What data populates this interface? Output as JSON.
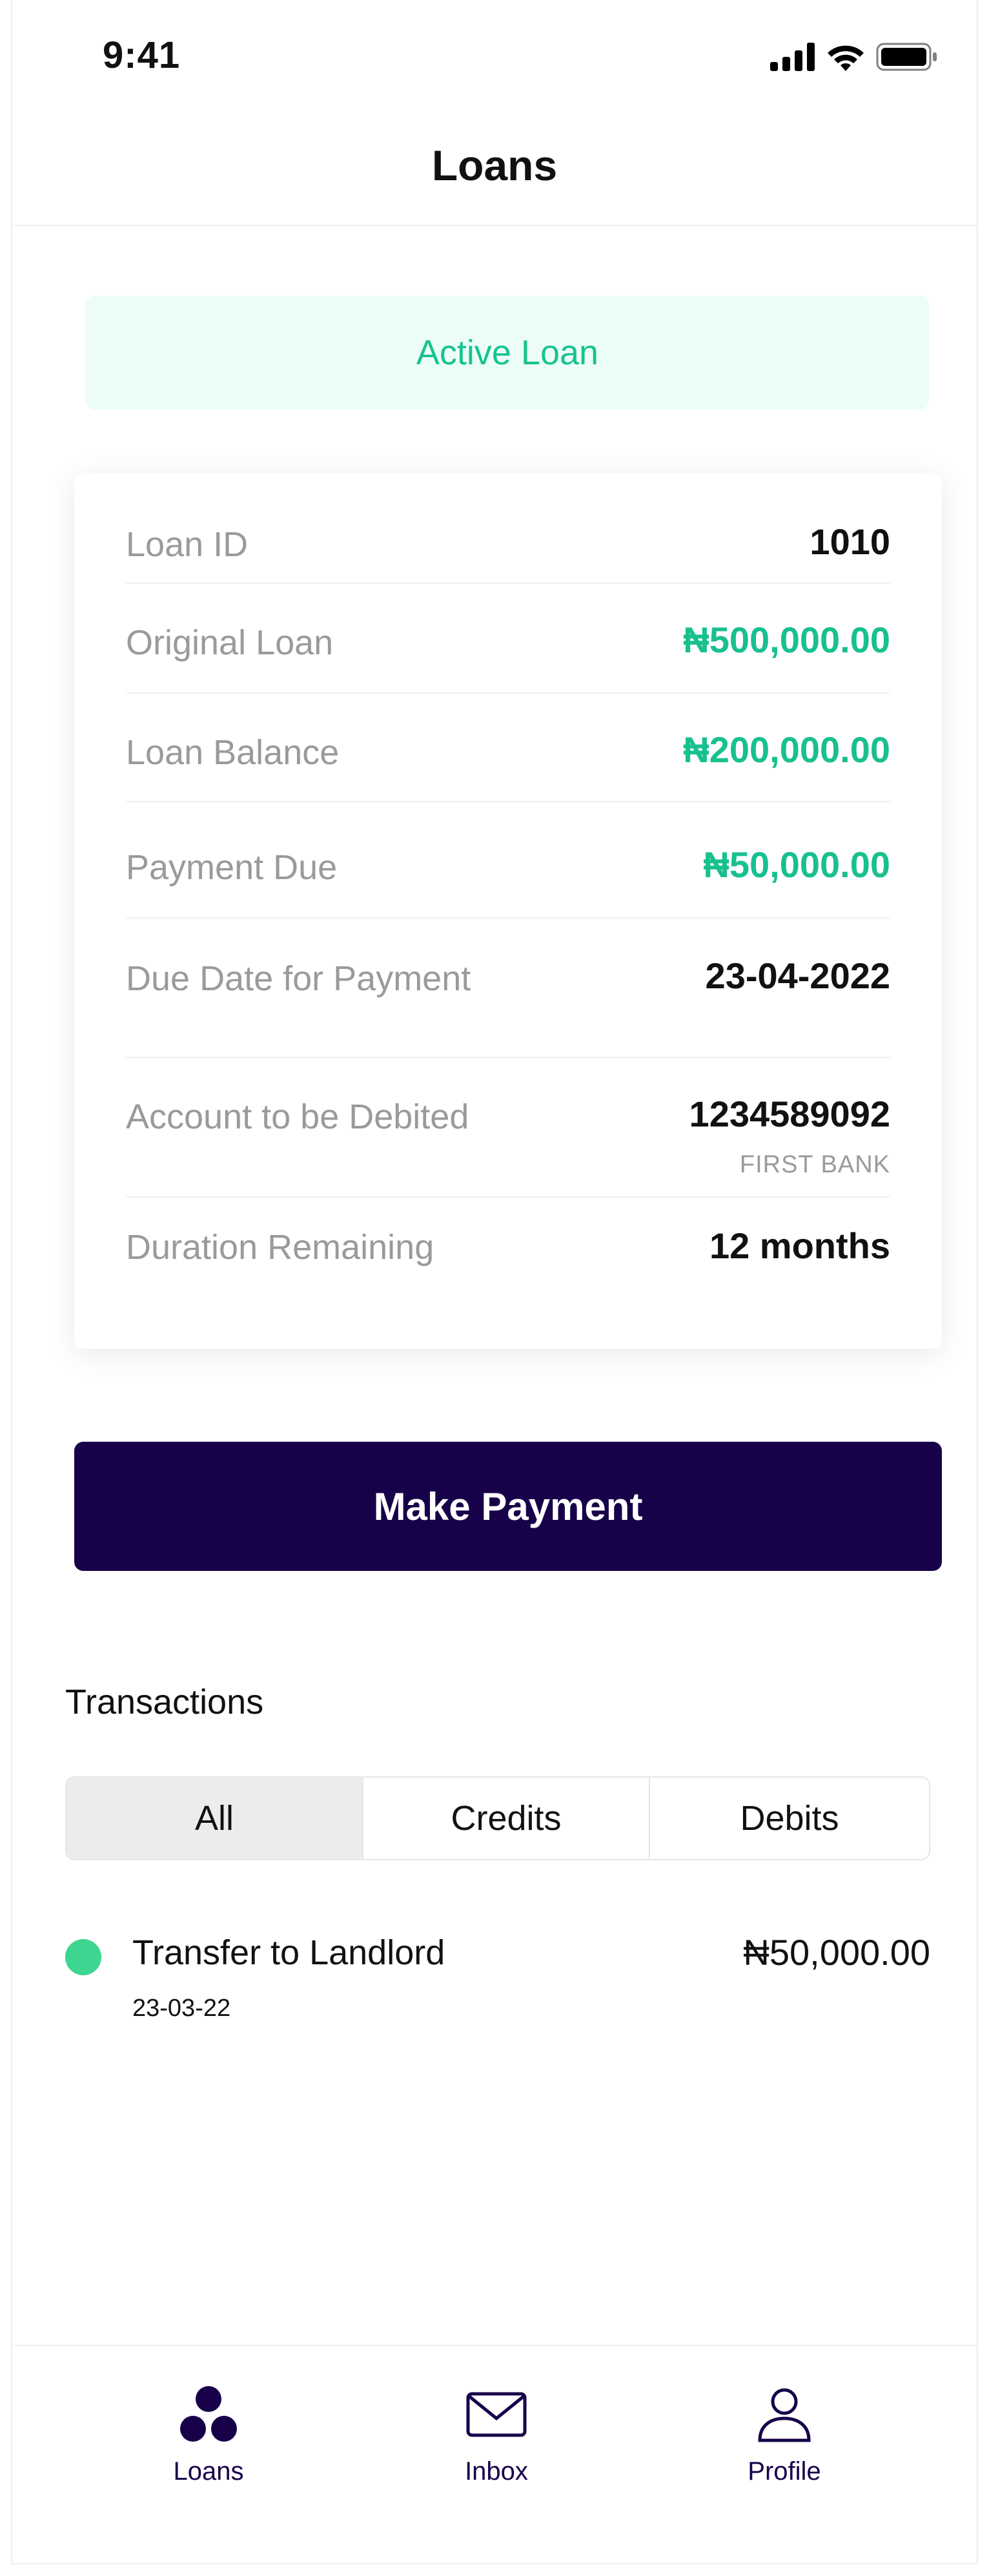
{
  "status_bar": {
    "time": "9:41",
    "icons": [
      "signal-icon",
      "wifi-icon",
      "battery-icon"
    ]
  },
  "header": {
    "title": "Loans"
  },
  "banner": {
    "label": "Active Loan"
  },
  "loan_details": {
    "loan_id": {
      "label": "Loan ID",
      "value": "1010"
    },
    "original_loan": {
      "label": "Original Loan",
      "value": "₦500,000.00"
    },
    "loan_balance": {
      "label": "Loan Balance",
      "value": "₦200,000.00"
    },
    "payment_due": {
      "label": "Payment Due",
      "value": "₦50,000.00"
    },
    "due_date": {
      "label": "Due Date for Payment",
      "value": "23-04-2022"
    },
    "account": {
      "label": "Account to be Debited",
      "value": "1234589092",
      "bank": "FIRST BANK"
    },
    "duration": {
      "label": "Duration Remaining",
      "value": "12 months"
    }
  },
  "actions": {
    "make_payment": "Make Payment"
  },
  "transactions": {
    "title": "Transactions",
    "tabs": [
      "All",
      "Credits",
      "Debits"
    ],
    "active_tab": "All",
    "items": [
      {
        "title": "Transfer to Landlord",
        "date": "23-03-22",
        "amount": "₦50,000.00",
        "status_color": "#3dd58f"
      }
    ]
  },
  "bottom_nav": {
    "items": [
      {
        "label": "Loans",
        "icon": "loans-icon"
      },
      {
        "label": "Inbox",
        "icon": "mail-icon"
      },
      {
        "label": "Profile",
        "icon": "profile-icon"
      }
    ]
  },
  "colors": {
    "primary": "#170149",
    "accent_green": "#18c08f",
    "banner_bg": "#ecfdf8",
    "label_gray": "#9a9a9a"
  }
}
